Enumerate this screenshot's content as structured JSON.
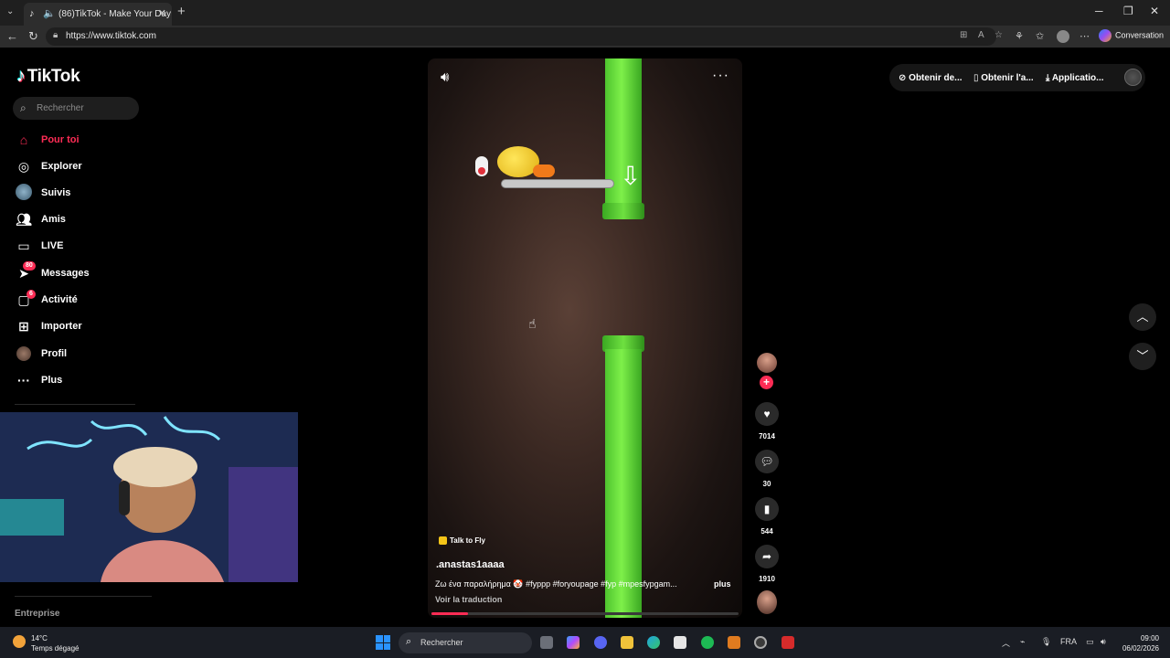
{
  "browser": {
    "tab_title": "(86)TikTok - Make Your Day",
    "url": "https://www.tiktok.com",
    "conversation_label": "Conversation"
  },
  "sidebar": {
    "logo": "TikTok",
    "search_placeholder": "Rechercher",
    "items": [
      {
        "label": "Pour toi",
        "icon": "home-icon"
      },
      {
        "label": "Explorer",
        "icon": "compass-icon"
      },
      {
        "label": "Suivis",
        "icon": "following-avatar-icon"
      },
      {
        "label": "Amis",
        "icon": "friends-icon"
      },
      {
        "label": "LIVE",
        "icon": "live-tv-icon"
      },
      {
        "label": "Messages",
        "icon": "messages-icon",
        "badge": "80"
      },
      {
        "label": "Activité",
        "icon": "activity-icon",
        "badge": "6"
      },
      {
        "label": "Importer",
        "icon": "upload-icon"
      },
      {
        "label": "Profil",
        "icon": "profile-icon"
      },
      {
        "label": "Plus",
        "icon": "more-icon"
      }
    ],
    "footer": "Entreprise"
  },
  "video": {
    "sound_label": "Talk to Fly",
    "author": ".anastas1aaaa",
    "caption": "Ζω ένα παραλήρημα 🤡 #fyppp #foryoupage #fyp #mpesfypgam...",
    "caption_more": "plus",
    "translate": "Voir la traduction",
    "progress": 0.12
  },
  "actions": {
    "likes": "7014",
    "comments": "30",
    "saves": "544",
    "shares": "1910"
  },
  "top_right": {
    "btn1": "Obtenir de...",
    "btn2": "Obtenir l'a...",
    "btn3": "Applicatio..."
  },
  "taskbar": {
    "temp": "14°C",
    "weather": "Temps dégagé",
    "search": "Rechercher",
    "lang": "FRA",
    "time": "09:00",
    "date": "06/02/2026"
  },
  "colors": {
    "accent": "#fe2c55",
    "pipe_green": "#5fd83a"
  }
}
